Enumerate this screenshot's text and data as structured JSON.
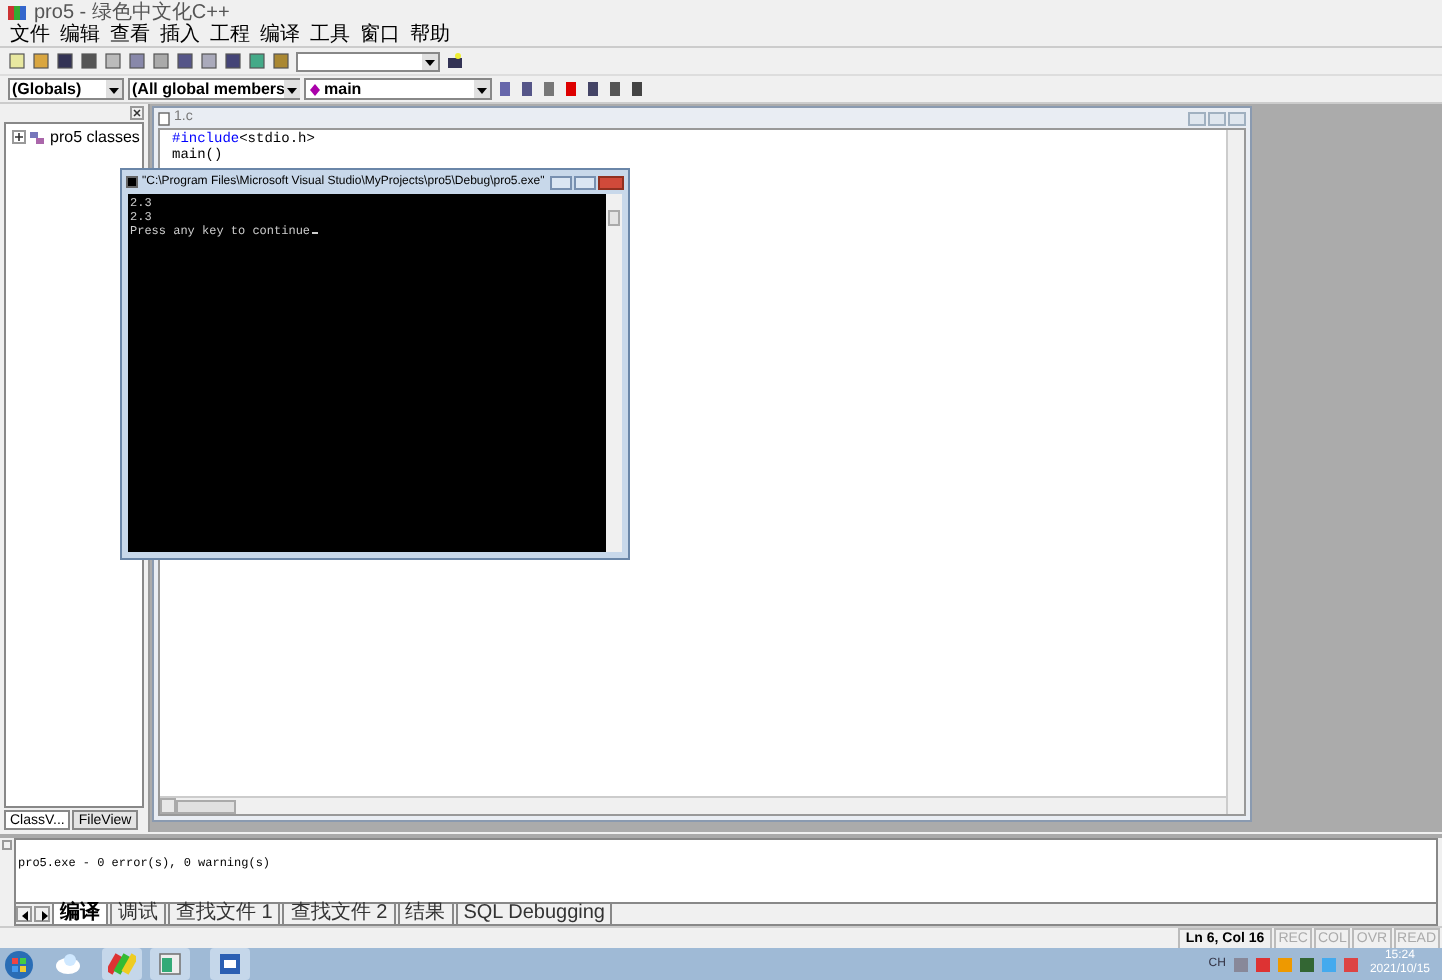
{
  "window": {
    "title": "pro5 - 绿色中文化C++"
  },
  "menu": [
    "文件",
    "编辑",
    "查看",
    "插入",
    "工程",
    "编译",
    "工具",
    "窗口",
    "帮助"
  ],
  "wizard_bar": {
    "scope": "(Globals)",
    "filter": "(All global members",
    "member": "main"
  },
  "workspace": {
    "tree": [
      {
        "label": "pro5 classes",
        "expanded": false
      }
    ],
    "tabs": [
      {
        "label": "ClassV...",
        "selected": true
      },
      {
        "label": "FileView",
        "selected": false
      }
    ]
  },
  "editor": {
    "title": "1.c",
    "lines": [
      [
        {
          "text": "#include",
          "kind": "keyword"
        },
        {
          "text": "<stdio.h>",
          "kind": "plain"
        }
      ],
      [
        {
          "text": "main()",
          "kind": "plain"
        }
      ]
    ]
  },
  "console": {
    "title": "\"C:\\Program Files\\Microsoft Visual Studio\\MyProjects\\pro5\\Debug\\pro5.exe\"",
    "lines": [
      "2.3",
      "2.3",
      "Press any key to continue"
    ]
  },
  "output": {
    "lines": [
      "pro5.exe - 0 error(s), 0 warning(s)"
    ],
    "tabs": [
      {
        "label": "编译",
        "selected": true
      },
      {
        "label": "调试",
        "selected": false
      },
      {
        "label": "查找文件 1",
        "selected": false
      },
      {
        "label": "查找文件 2",
        "selected": false
      },
      {
        "label": "结果",
        "selected": false
      },
      {
        "label": "SQL Debugging",
        "selected": false
      }
    ]
  },
  "status_bar": {
    "position": "Ln 6, Col 16",
    "indicators": [
      "REC",
      "COL",
      "OVR",
      "READ"
    ]
  },
  "taskbar": {
    "tray_lang": "CH",
    "time": "15:24",
    "date": "2021/10/15"
  }
}
